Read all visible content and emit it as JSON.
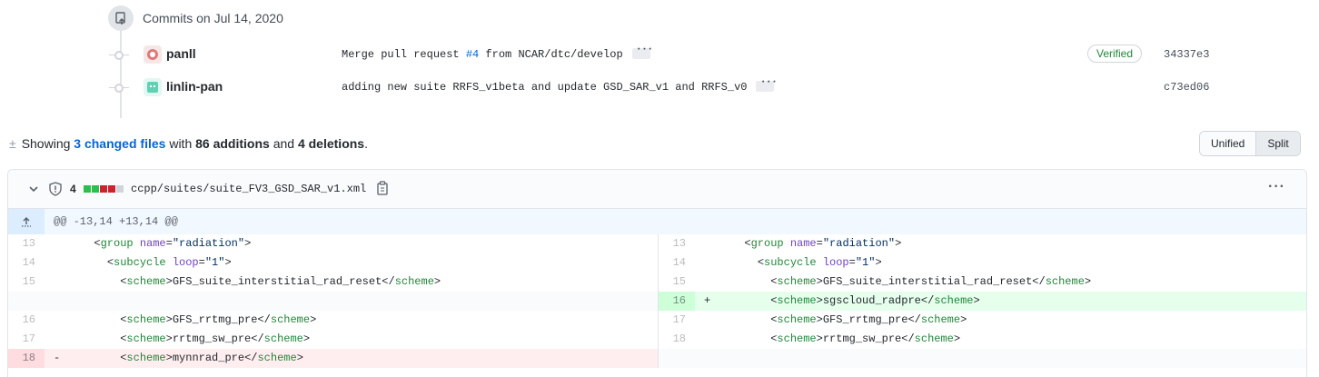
{
  "timeline": {
    "heading": "Commits on Jul 14, 2020"
  },
  "commits": [
    {
      "author": "panll",
      "message_prefix": "Merge pull request ",
      "pr_ref": "#4",
      "message_suffix": " from NCAR/dtc/develop",
      "verified": "Verified",
      "sha": "34337e3"
    },
    {
      "author": "linlin-pan",
      "message_prefix": "adding new suite RRFS_v1beta and update GSD_SAR_v1 and RRFS_v0",
      "pr_ref": "",
      "message_suffix": "",
      "verified": "",
      "sha": "c73ed06"
    }
  ],
  "diffstat": {
    "showing": "Showing ",
    "changed_files": "3 changed files",
    "with": " with ",
    "additions": "86 additions",
    "and": " and ",
    "deletions": "4 deletions",
    "period": "."
  },
  "view_toggle": {
    "unified": "Unified",
    "split": "Split",
    "selected": "Split"
  },
  "file": {
    "change_count": "4",
    "stat_blocks": [
      "add",
      "add",
      "del",
      "del",
      "neutral"
    ],
    "path": "ccpp/suites/suite_FV3_GSD_SAR_v1.xml",
    "hunk_header": "@@ -13,14 +13,14 @@"
  },
  "diff": {
    "left": [
      {
        "num": "13",
        "type": "context",
        "marker": "",
        "indent": "  ",
        "open": "<",
        "tag": "group",
        "attr": " name",
        "eq": "=",
        "val": "\"radiation\"",
        "close": ">",
        "text": "",
        "endtag": ""
      },
      {
        "num": "14",
        "type": "context",
        "marker": "",
        "indent": "    ",
        "open": "<",
        "tag": "subcycle",
        "attr": " loop",
        "eq": "=",
        "val": "\"1\"",
        "close": ">",
        "text": "",
        "endtag": ""
      },
      {
        "num": "15",
        "type": "context",
        "marker": "",
        "indent": "      ",
        "open": "<",
        "tag": "scheme",
        "attr": "",
        "eq": "",
        "val": "",
        "close": ">",
        "text": "GFS_suite_interstitial_rad_reset",
        "endtag": "scheme"
      },
      {
        "num": "",
        "type": "empty",
        "marker": "",
        "indent": "",
        "open": "",
        "tag": "",
        "attr": "",
        "eq": "",
        "val": "",
        "close": "",
        "text": "",
        "endtag": ""
      },
      {
        "num": "16",
        "type": "context",
        "marker": "",
        "indent": "      ",
        "open": "<",
        "tag": "scheme",
        "attr": "",
        "eq": "",
        "val": "",
        "close": ">",
        "text": "GFS_rrtmg_pre",
        "endtag": "scheme"
      },
      {
        "num": "17",
        "type": "context",
        "marker": "",
        "indent": "      ",
        "open": "<",
        "tag": "scheme",
        "attr": "",
        "eq": "",
        "val": "",
        "close": ">",
        "text": "rrtmg_sw_pre",
        "endtag": "scheme"
      },
      {
        "num": "18",
        "type": "del",
        "marker": "-",
        "indent": "      ",
        "open": "<",
        "tag": "scheme",
        "attr": "",
        "eq": "",
        "val": "",
        "close": ">",
        "text": "mynnrad_pre",
        "endtag": "scheme"
      }
    ],
    "right": [
      {
        "num": "13",
        "type": "context",
        "marker": "",
        "indent": "  ",
        "open": "<",
        "tag": "group",
        "attr": " name",
        "eq": "=",
        "val": "\"radiation\"",
        "close": ">",
        "text": "",
        "endtag": ""
      },
      {
        "num": "14",
        "type": "context",
        "marker": "",
        "indent": "    ",
        "open": "<",
        "tag": "subcycle",
        "attr": " loop",
        "eq": "=",
        "val": "\"1\"",
        "close": ">",
        "text": "",
        "endtag": ""
      },
      {
        "num": "15",
        "type": "context",
        "marker": "",
        "indent": "      ",
        "open": "<",
        "tag": "scheme",
        "attr": "",
        "eq": "",
        "val": "",
        "close": ">",
        "text": "GFS_suite_interstitial_rad_reset",
        "endtag": "scheme"
      },
      {
        "num": "16",
        "type": "add",
        "marker": "+",
        "indent": "      ",
        "open": "<",
        "tag": "scheme",
        "attr": "",
        "eq": "",
        "val": "",
        "close": ">",
        "text": "sgscloud_radpre",
        "endtag": "scheme"
      },
      {
        "num": "17",
        "type": "context",
        "marker": "",
        "indent": "      ",
        "open": "<",
        "tag": "scheme",
        "attr": "",
        "eq": "",
        "val": "",
        "close": ">",
        "text": "GFS_rrtmg_pre",
        "endtag": "scheme"
      },
      {
        "num": "18",
        "type": "context",
        "marker": "",
        "indent": "      ",
        "open": "<",
        "tag": "scheme",
        "attr": "",
        "eq": "",
        "val": "",
        "close": ">",
        "text": "rrtmg_sw_pre",
        "endtag": "scheme"
      },
      {
        "num": "",
        "type": "empty",
        "marker": "",
        "indent": "",
        "open": "",
        "tag": "",
        "attr": "",
        "eq": "",
        "val": "",
        "close": "",
        "text": "",
        "endtag": ""
      }
    ]
  },
  "colors": {
    "link": "#0366d6",
    "verified": "#22863a",
    "add_bg": "#e6ffed",
    "del_bg": "#ffeef0",
    "stat_add": "#2cbe4e",
    "stat_del": "#cb2431",
    "stat_neutral": "#d1d5da"
  }
}
